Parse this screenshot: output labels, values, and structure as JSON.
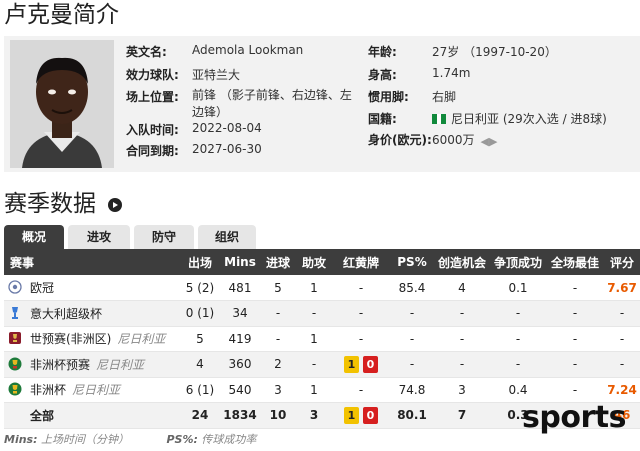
{
  "page_title": "卢克曼简介",
  "profile": {
    "english_name_label": "英文名:",
    "english_name": "Ademola Lookman",
    "club_label": "效力球队:",
    "club": "亚特兰大",
    "position_label": "场上位置:",
    "position": "前锋 （影子前锋、右边锋、左边锋）",
    "join_label": "入队时间:",
    "join_date": "2022-08-04",
    "contract_label": "合同到期:",
    "contract_date": "2027-06-30",
    "age_label": "年龄:",
    "age": "27岁 （1997-10-20）",
    "height_label": "身高:",
    "height": "1.74m",
    "foot_label": "惯用脚:",
    "foot": "右脚",
    "nationality_label": "国籍:",
    "nationality": "尼日利亚 (29次入选 / 进8球)",
    "value_label": "身价(欧元):",
    "value": "6000万"
  },
  "season": {
    "title": "赛季数据",
    "tabs": [
      {
        "label": "概况",
        "active": true
      },
      {
        "label": "进攻",
        "active": false
      },
      {
        "label": "防守",
        "active": false
      },
      {
        "label": "组织",
        "active": false
      }
    ],
    "headers": [
      "赛事",
      "出场",
      "Mins",
      "进球",
      "助攻",
      "红黄牌",
      "PS%",
      "创造机会",
      "争顶成功",
      "全场最佳",
      "评分"
    ],
    "rows": [
      {
        "comp": "欧冠",
        "team": "",
        "icon": "ucl",
        "apps": "5 (2)",
        "mins": "481",
        "goals": "5",
        "assists": "1",
        "cards": "-",
        "ps": "85.4",
        "chances": "4",
        "aerial": "0.1",
        "motm": "-",
        "rating": "7.67"
      },
      {
        "comp": "意大利超级杯",
        "team": "",
        "icon": "supercup",
        "apps": "0 (1)",
        "mins": "34",
        "goals": "-",
        "assists": "-",
        "cards": "-",
        "ps": "-",
        "chances": "-",
        "aerial": "-",
        "motm": "-",
        "rating": "-"
      },
      {
        "comp": "世预赛(非洲区)",
        "team": "尼日利亚",
        "icon": "wc",
        "apps": "5",
        "mins": "419",
        "goals": "-",
        "assists": "1",
        "cards": "-",
        "ps": "-",
        "chances": "-",
        "aerial": "-",
        "motm": "-",
        "rating": "-"
      },
      {
        "comp": "非洲杯预赛",
        "team": "尼日利亚",
        "icon": "afcon",
        "apps": "4",
        "mins": "360",
        "goals": "2",
        "assists": "-",
        "cards_yellow": "1",
        "cards_red": "0",
        "ps": "-",
        "chances": "-",
        "aerial": "-",
        "motm": "-",
        "rating": "-"
      },
      {
        "comp": "非洲杯",
        "team": "尼日利亚",
        "icon": "afcon",
        "apps": "6 (1)",
        "mins": "540",
        "goals": "3",
        "assists": "1",
        "cards": "-",
        "ps": "74.8",
        "chances": "3",
        "aerial": "0.4",
        "motm": "-",
        "rating": "7.24"
      }
    ],
    "total": {
      "label": "全部",
      "apps": "24",
      "mins": "1834",
      "goals": "10",
      "assists": "3",
      "cards_yellow": "1",
      "cards_red": "0",
      "ps": "80.1",
      "chances": "7",
      "aerial": "0.3",
      "rating": "46"
    }
  },
  "footnote": {
    "mins_key": "Mins:",
    "mins_desc": "上场时间（分钟）",
    "ps_key": "PS%:",
    "ps_desc": "传球成功率"
  },
  "watermark": "sports",
  "colors": {
    "header_bg": "#3d3d3d",
    "rating": "#e85a00",
    "yellow_card": "#f2c200",
    "red_card": "#d61f1f"
  }
}
